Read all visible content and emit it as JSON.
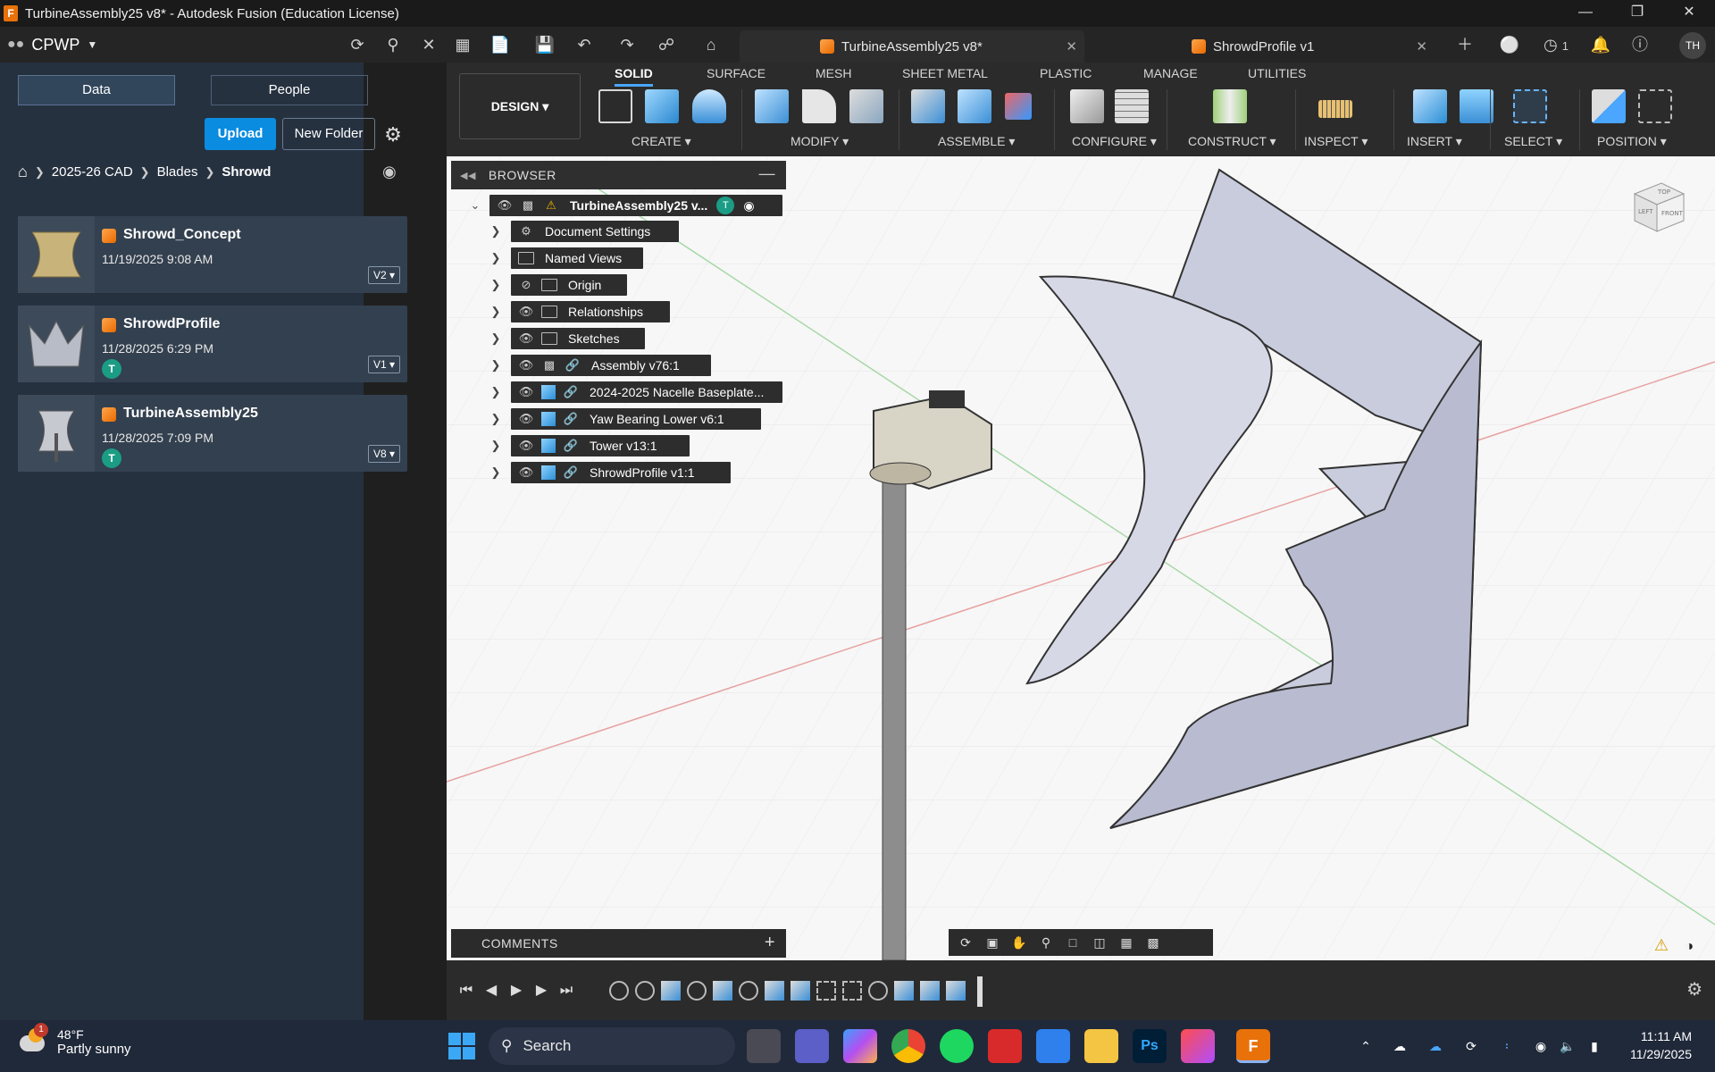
{
  "window": {
    "title": "TurbineAssembly25 v8* - Autodesk Fusion (Education License)",
    "controls": [
      "minimize-icon",
      "restore-icon",
      "close-icon"
    ]
  },
  "appbar": {
    "team": "CPWP",
    "tabs": [
      {
        "label": "TurbineAssembly25 v8*",
        "active": true
      },
      {
        "label": "ShrowdProfile v1",
        "active": false
      }
    ],
    "notification_count": "1",
    "user_initials": "TH"
  },
  "data_panel": {
    "tab_data": "Data",
    "tab_people": "People",
    "upload": "Upload",
    "new_folder": "New Folder",
    "breadcrumb": [
      "2025-26 CAD",
      "Blades",
      "Shrowd"
    ],
    "files": [
      {
        "name": "Shrowd_Concept",
        "date": "11/19/2025 9:08 AM",
        "version": "V2",
        "user": ""
      },
      {
        "name": "ShrowdProfile",
        "date": "11/28/2025 6:29 PM",
        "version": "V1",
        "user": "T"
      },
      {
        "name": "TurbineAssembly25",
        "date": "11/28/2025 7:09 PM",
        "version": "V8",
        "user": "T"
      }
    ]
  },
  "toolbar": {
    "workspace": "DESIGN",
    "tabs": [
      "SOLID",
      "SURFACE",
      "MESH",
      "SHEET METAL",
      "PLASTIC",
      "MANAGE",
      "UTILITIES"
    ],
    "active_tab": "SOLID",
    "groups": [
      "CREATE",
      "MODIFY",
      "ASSEMBLE",
      "CONFIGURE",
      "CONSTRUCT",
      "INSPECT",
      "INSERT",
      "SELECT",
      "POSITION"
    ]
  },
  "browser": {
    "title": "BROWSER",
    "root": "TurbineAssembly25 v...",
    "root_badge": "T",
    "items": [
      "Document Settings",
      "Named Views",
      "Origin",
      "Relationships",
      "Sketches",
      "Assembly v76:1",
      "2024-2025 Nacelle Baseplate...",
      "Yaw Bearing Lower v6:1",
      "Tower v13:1",
      "ShrowdProfile v1:1"
    ]
  },
  "viewcube": {
    "top": "TOP",
    "front": "FRONT",
    "left": "LEFT"
  },
  "comments": {
    "title": "COMMENTS"
  },
  "taskbar": {
    "weather_temp": "48°F",
    "weather_cond": "Partly sunny",
    "weather_badge": "1",
    "search": "Search",
    "time": "11:11 AM",
    "date": "11/29/2025"
  },
  "colors": {
    "accent": "#0a8ce0",
    "data_panel_bg": "#263140",
    "viewport_bg": "#f7f7f7",
    "shroud": "#c9ccdd",
    "fusion_orange": "#e8710a"
  }
}
